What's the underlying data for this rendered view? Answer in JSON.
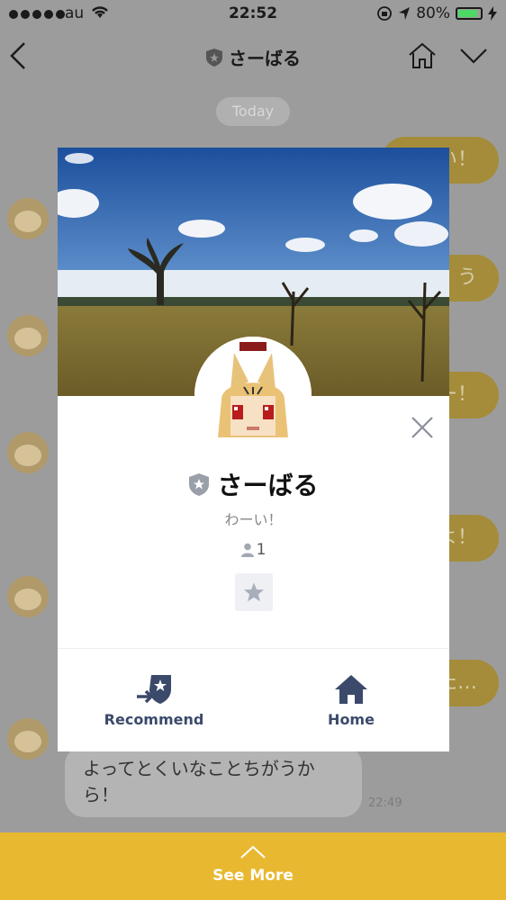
{
  "status_bar": {
    "carrier": "au",
    "time": "22:52",
    "battery": "80%",
    "battery_level": 0.8
  },
  "nav": {
    "title": "さーばる",
    "icons": [
      "back-chevron-icon",
      "official-shield-icon",
      "home-icon",
      "chevron-down-icon"
    ]
  },
  "chat": {
    "date_chip": "Today",
    "right_bubbles": [
      "い！",
      "う",
      "ー！",
      "よ！",
      "た…"
    ],
    "last_message": "よってとくいなことちがうから！",
    "last_time": "22:49"
  },
  "modal": {
    "name": "さーばる",
    "status_message": "わーい！",
    "friend_count": "1",
    "actions": [
      {
        "label": "Recommend",
        "icon": "recommend-shield-icon"
      },
      {
        "label": "Home",
        "icon": "home-icon"
      }
    ]
  },
  "bottom": {
    "label": "See More"
  },
  "colors": {
    "accent": "#e8b830",
    "action_text": "#3b4a6b",
    "bubble_right": "#a48c3a"
  }
}
